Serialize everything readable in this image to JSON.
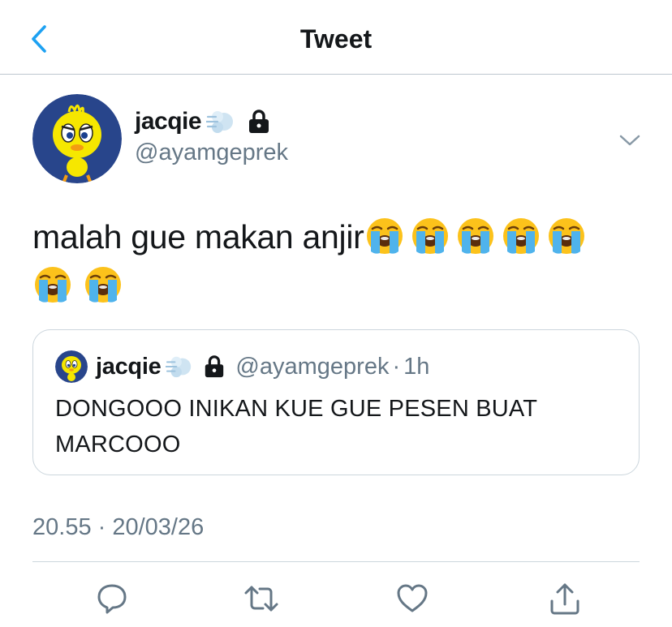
{
  "header": {
    "title": "Tweet",
    "back_icon": "chevron-left-icon"
  },
  "tweet": {
    "author": {
      "display_name": "jacqie",
      "handle": "@ayamgeprek",
      "badges": [
        "dash-emoji",
        "lock-icon"
      ]
    },
    "text": "malah gue makan anjir",
    "emoji_name": "loudly-crying-face",
    "emoji_count": 7,
    "timestamp": "20.55 · 20/03/26"
  },
  "quote": {
    "display_name": "jacqie",
    "handle": "@ayamgeprek",
    "separator": "·",
    "time_ago": "1h",
    "text": "DONGOOO INIKAN KUE GUE PESEN BUAT MARCOOO"
  },
  "actions": [
    "reply-icon",
    "retweet-icon",
    "like-icon",
    "share-icon"
  ],
  "colors": {
    "accent": "#1da1f2",
    "muted": "#657786",
    "border": "#ccd6dd"
  }
}
